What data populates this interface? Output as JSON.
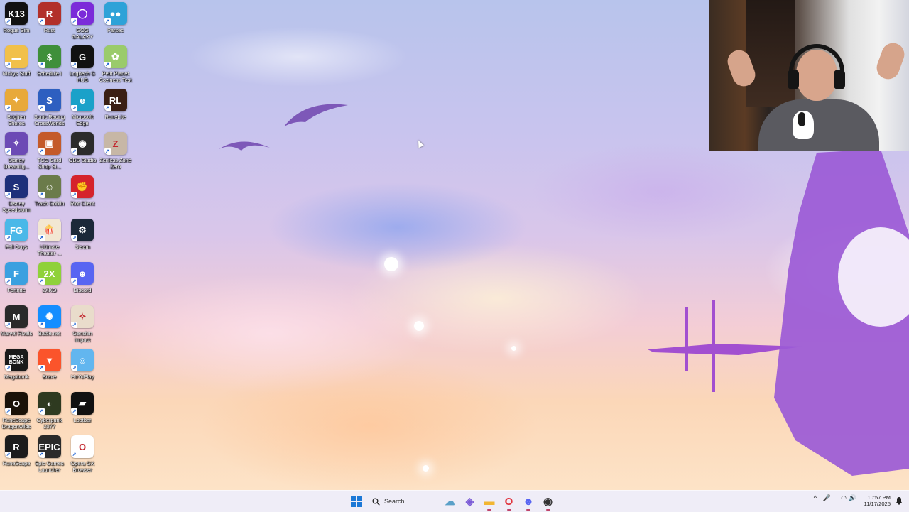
{
  "desktop_icons": [
    {
      "label": "Rogue Sim",
      "glyph": "K13",
      "bg": "#111111",
      "col": 0,
      "row": 0
    },
    {
      "label": "Rust",
      "glyph": "R",
      "bg": "#b2302a",
      "col": 1,
      "row": 0
    },
    {
      "label": "GOG GALAXY",
      "glyph": "◯",
      "bg": "#7b2bd9",
      "col": 2,
      "row": 0
    },
    {
      "label": "Parsec",
      "glyph": "●●",
      "bg": "#2ea2d8",
      "col": 3,
      "row": 0
    },
    {
      "label": "Nickys Stuff",
      "glyph": "▬",
      "bg": "#f1c04a",
      "col": 0,
      "row": 1
    },
    {
      "label": "Schedule I",
      "glyph": "$",
      "bg": "#3f8f3a",
      "col": 1,
      "row": 1
    },
    {
      "label": "Logitech G HUB",
      "glyph": "G",
      "bg": "#111111",
      "col": 2,
      "row": 1
    },
    {
      "label": "Petit Planet Coziness Test",
      "glyph": "✿",
      "bg": "#9acb6b",
      "col": 3,
      "row": 1
    },
    {
      "label": "Brighter Shores",
      "glyph": "✦",
      "bg": "#e8a93a",
      "col": 0,
      "row": 2
    },
    {
      "label": "Sonic Racing CrossWorlds",
      "glyph": "S",
      "bg": "#2d5fc0",
      "col": 1,
      "row": 2
    },
    {
      "label": "Microsoft Edge",
      "glyph": "e",
      "bg": "#1aa1c9",
      "col": 2,
      "row": 2
    },
    {
      "label": "RuneLite",
      "glyph": "RL",
      "bg": "#3a1f14",
      "col": 3,
      "row": 2
    },
    {
      "label": "Disney Dreamlig...",
      "glyph": "✧",
      "bg": "#6c4ab5",
      "col": 0,
      "row": 3
    },
    {
      "label": "TCG Card Shop Si...",
      "glyph": "▣",
      "bg": "#c45a2a",
      "col": 1,
      "row": 3
    },
    {
      "label": "OBS Studio",
      "glyph": "◉",
      "bg": "#2b2b2b",
      "col": 2,
      "row": 3
    },
    {
      "label": "Zenless Zone Zero",
      "glyph": "Z",
      "bg": "#c7b7a6",
      "col": 3,
      "row": 3
    },
    {
      "label": "Disney Speedstorm",
      "glyph": "S",
      "bg": "#1e2f7a",
      "col": 0,
      "row": 4
    },
    {
      "label": "Trash Goblin",
      "glyph": "☺",
      "bg": "#6b7b4a",
      "col": 1,
      "row": 4
    },
    {
      "label": "Riot Client",
      "glyph": "✊",
      "bg": "#d5232b",
      "col": 2,
      "row": 4
    },
    {
      "label": "Fall Guys",
      "glyph": "FG",
      "bg": "#4ab8e8",
      "col": 0,
      "row": 5
    },
    {
      "label": "Ultimate Theater ...",
      "glyph": "🍿",
      "bg": "#f2e7d3",
      "col": 1,
      "row": 5
    },
    {
      "label": "Steam",
      "glyph": "⚙",
      "bg": "#1b2838",
      "col": 2,
      "row": 5
    },
    {
      "label": "Fortnite",
      "glyph": "F",
      "bg": "#3aa0e0",
      "col": 0,
      "row": 6
    },
    {
      "label": "2XKO",
      "glyph": "2X",
      "bg": "#8fd13a",
      "col": 1,
      "row": 6
    },
    {
      "label": "Discord",
      "glyph": "☻",
      "bg": "#5865f2",
      "col": 2,
      "row": 6
    },
    {
      "label": "Marvel Rivals",
      "glyph": "M",
      "bg": "#2a2a2a",
      "col": 0,
      "row": 7
    },
    {
      "label": "Battle.net",
      "glyph": "✺",
      "bg": "#148eff",
      "col": 1,
      "row": 7
    },
    {
      "label": "Genshin Impact",
      "glyph": "✧",
      "bg": "#e9dccb",
      "col": 2,
      "row": 7
    },
    {
      "label": "Megabonk",
      "glyph": "MEGA BONK",
      "bg": "#1a1a1a",
      "col": 0,
      "row": 8
    },
    {
      "label": "Brave",
      "glyph": "▼",
      "bg": "#fb542b",
      "col": 1,
      "row": 8
    },
    {
      "label": "HoYoPlay",
      "glyph": "☺",
      "bg": "#62b6ef",
      "col": 2,
      "row": 8
    },
    {
      "label": "RuneScape Dragonwilds",
      "glyph": "O",
      "bg": "#1a1208",
      "col": 0,
      "row": 9
    },
    {
      "label": "Cyberpunk 2077",
      "glyph": "◐",
      "bg": "#2e3a20",
      "col": 1,
      "row": 9
    },
    {
      "label": "Lootbar",
      "glyph": "▰",
      "bg": "#111111",
      "col": 2,
      "row": 9
    },
    {
      "label": "RuneScape",
      "glyph": "R",
      "bg": "#1c1c1c",
      "col": 0,
      "row": 10
    },
    {
      "label": "Epic Games Launcher",
      "glyph": "EPIC",
      "bg": "#2a2a2a",
      "col": 1,
      "row": 10
    },
    {
      "label": "Opera GX Browser",
      "glyph": "O",
      "bg": "#ffffff",
      "col": 2,
      "row": 10
    }
  ],
  "taskbar": {
    "search_label": "Search",
    "apps": [
      {
        "name": "widgets-weather",
        "glyph": "☁",
        "color": "#5aa0c8"
      },
      {
        "name": "copilot",
        "glyph": "◈",
        "color": "#7b5bd6"
      },
      {
        "name": "file-explorer",
        "glyph": "▬",
        "color": "#f2b632"
      },
      {
        "name": "opera-gx",
        "glyph": "O",
        "color": "#e0343d"
      },
      {
        "name": "discord",
        "glyph": "☻",
        "color": "#5865f2"
      },
      {
        "name": "chrome-dev",
        "glyph": "◉",
        "color": "#333333"
      }
    ],
    "tray": {
      "chevron": "^",
      "mic": "🎤",
      "wifi": "◠",
      "volume": "🔊"
    },
    "clock_time": "10:57 PM",
    "clock_date": "11/17/2025"
  },
  "colors": {
    "accent": "#1c78d6",
    "taskbar_bg": "#eeecf6"
  }
}
